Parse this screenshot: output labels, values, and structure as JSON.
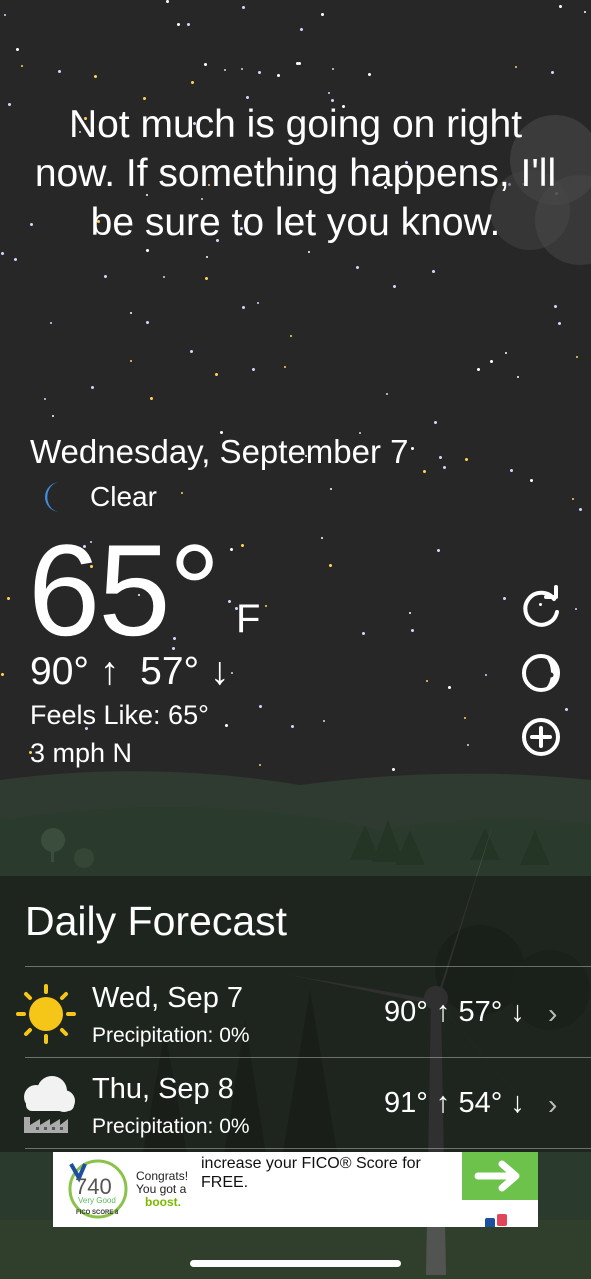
{
  "status_message": "Not much is going on right now. If something happens, I'll be sure to let you know.",
  "current": {
    "date": "Wednesday, September 7",
    "condition_icon": "moon-icon",
    "condition": "Clear",
    "temperature": "65°",
    "unit": "F",
    "high": "90°",
    "low": "57°",
    "feels_like": "Feels Like: 65°",
    "wind": "3 mph N"
  },
  "side_actions": [
    {
      "name": "refresh",
      "icon": "refresh-icon"
    },
    {
      "name": "moon-phase",
      "icon": "moon-phase-icon"
    },
    {
      "name": "add-location",
      "icon": "add-circle-icon"
    }
  ],
  "forecast": {
    "title": "Daily Forecast",
    "days": [
      {
        "day": "Wed, Sep 7",
        "precip": "Precipitation: 0%",
        "high": "90°",
        "low": "57°",
        "icon": "sun-icon"
      },
      {
        "day": "Thu, Sep 8",
        "precip": "Precipitation: 0%",
        "high": "91°",
        "low": "54°",
        "icon": "cloud-smog-icon"
      }
    ]
  },
  "ad": {
    "score": "740",
    "score_label": "Very Good",
    "brand": "FICO SCORE 8",
    "congrats": "Congrats! You got a",
    "boost": "boost.",
    "headline": "increase your FICO® Score for FREE.",
    "cta_icon": "arrow-right-icon"
  },
  "colors": {
    "background": "#272727",
    "moon": "#3f8ee0",
    "sun": "#f5c518",
    "ad_green": "#6cc24a"
  }
}
